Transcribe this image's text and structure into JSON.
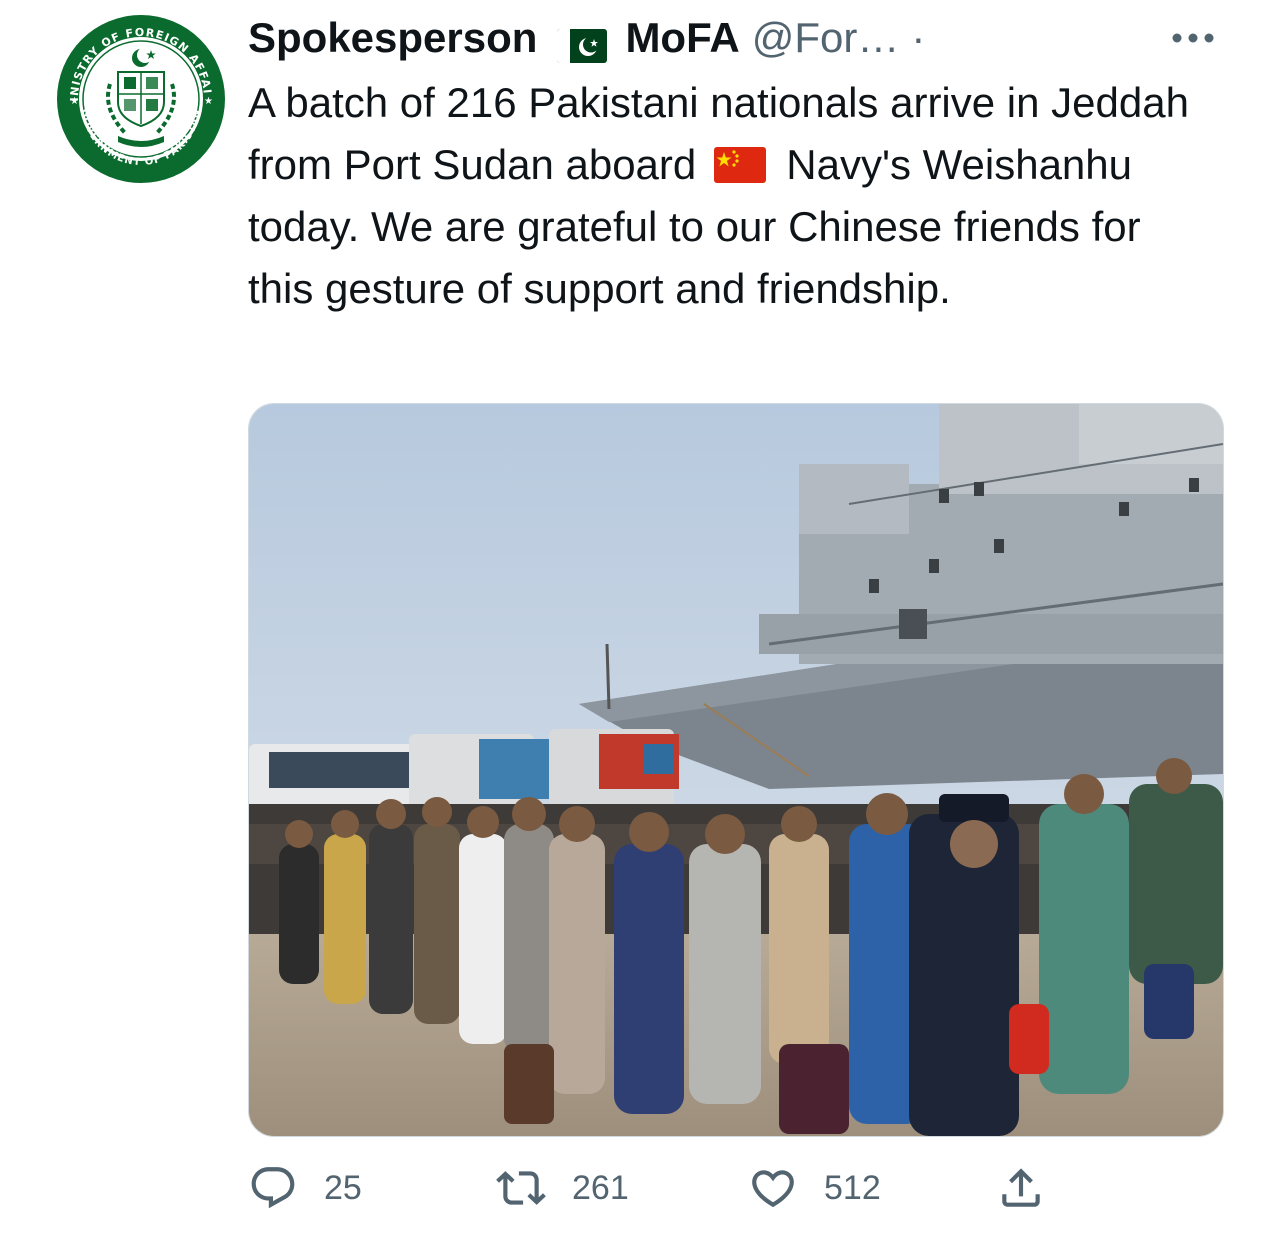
{
  "author": {
    "display_name": "Spokesperson",
    "display_name_suffix": "MoFA",
    "handle": "@For…",
    "separator": "·",
    "avatar_ring_top": "MINISTRY OF FOREIGN AFFAIRS",
    "avatar_ring_bottom": "GOVERNMENT OF PAKISTAN"
  },
  "tweet": {
    "text_part1": "A batch of 216 Pakistani nationals arrive in Jeddah from Port Sudan aboard",
    "text_part2": "Navy's Weishanhu today. We are grateful to our Chinese friends for this gesture of support and friendship.",
    "flag_1": "pakistan-flag-emoji",
    "flag_2": "china-flag-emoji"
  },
  "actions": {
    "reply_count": "25",
    "retweet_count": "261",
    "like_count": "512"
  },
  "icons": {
    "more": "more-horizontal-icon",
    "reply": "reply-icon",
    "retweet": "retweet-icon",
    "like": "heart-icon",
    "share": "share-icon"
  },
  "colors": {
    "text": "#0f1419",
    "secondary": "#536471",
    "seal_green": "#0b6b2e",
    "flag_green": "#01411c",
    "flag_red": "#de2910",
    "flag_yellow": "#ffde00"
  }
}
